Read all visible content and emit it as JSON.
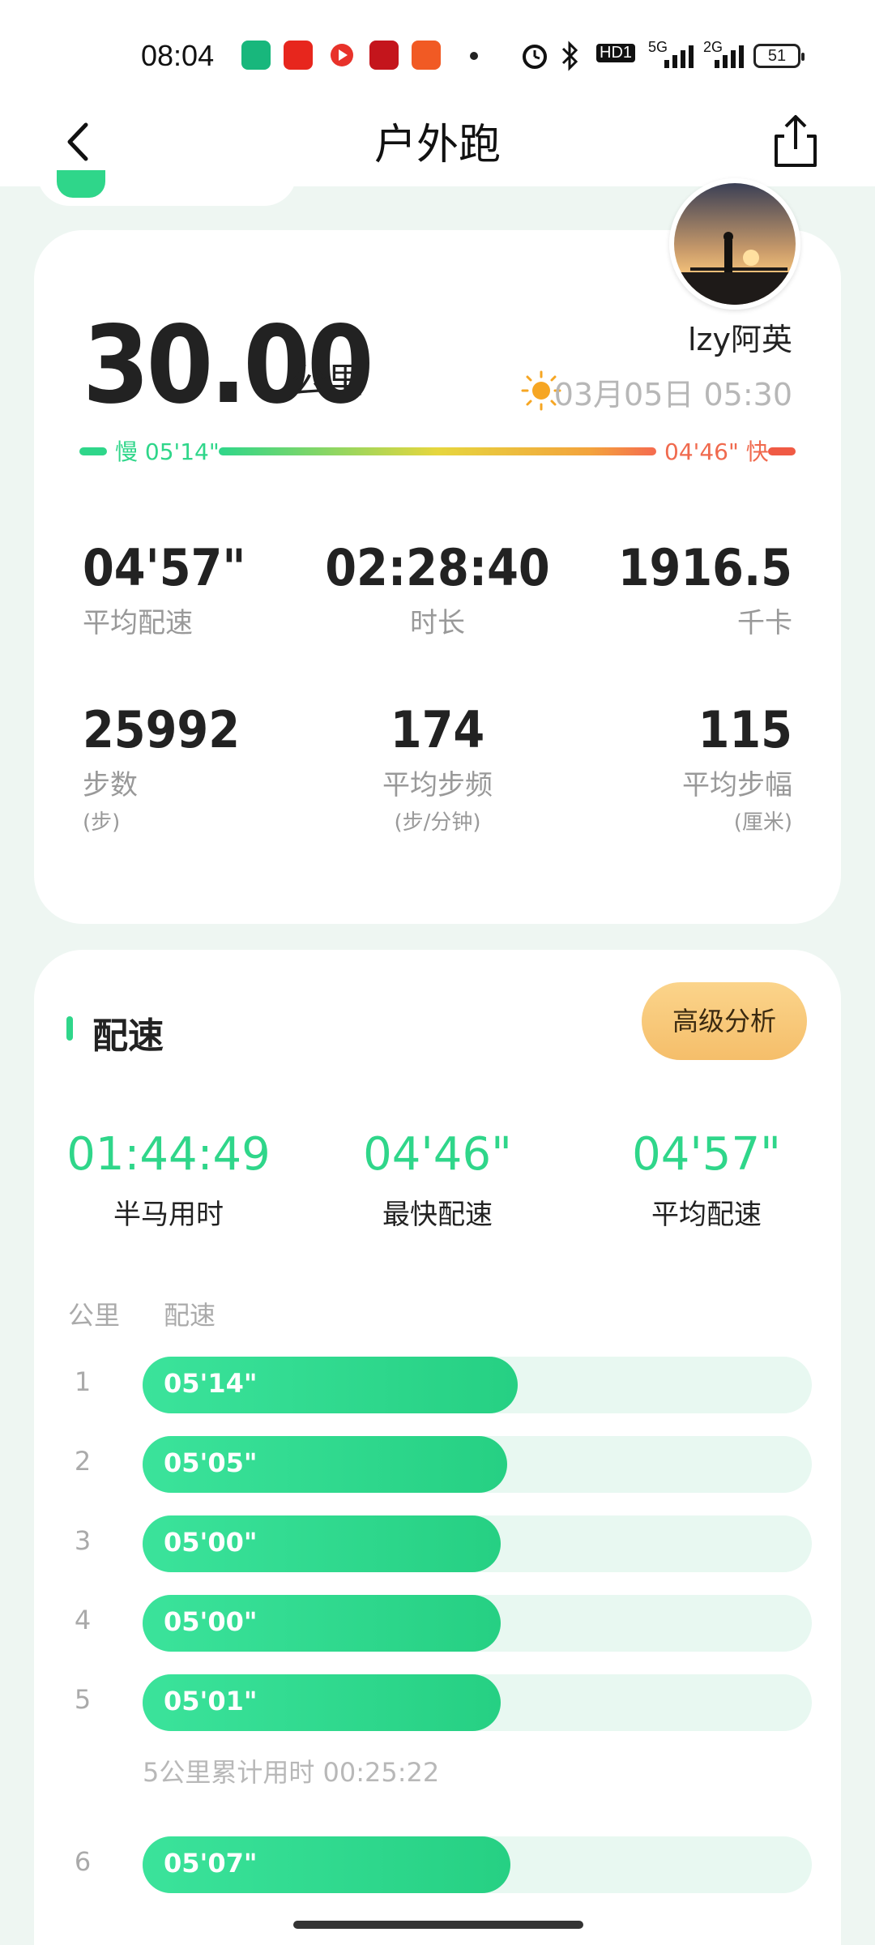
{
  "status_bar": {
    "time": "08:04",
    "network1": "5G",
    "network2": "2G",
    "hd": "HD1",
    "battery": "51"
  },
  "header": {
    "title": "户外跑"
  },
  "summary": {
    "distance": "30.00",
    "distance_unit": "公里",
    "user": "lzy阿英",
    "datetime": "03月05日 05:30",
    "pace_slow": "慢 05'14\"",
    "pace_fast": "04'46\" 快",
    "stats": [
      {
        "value": "04'57\"",
        "label": "平均配速",
        "unit": ""
      },
      {
        "value": "02:28:40",
        "label": "时长",
        "unit": ""
      },
      {
        "value": "1916.5",
        "label": "千卡",
        "unit": ""
      },
      {
        "value": "25992",
        "label": "步数",
        "unit": "(步)"
      },
      {
        "value": "174",
        "label": "平均步频",
        "unit": "(步/分钟)"
      },
      {
        "value": "115",
        "label": "平均步幅",
        "unit": "(厘米)"
      }
    ]
  },
  "pace_section": {
    "title": "配速",
    "advanced_button": "高级分析",
    "highlights": [
      {
        "value": "01:44:49",
        "label": "半马用时"
      },
      {
        "value": "04'46\"",
        "label": "最快配速"
      },
      {
        "value": "04'57\"",
        "label": "平均配速"
      }
    ],
    "col_km": "公里",
    "col_pace": "配速",
    "splits": [
      {
        "km": "1",
        "pace": "05'14\"",
        "fraction": 0.56
      },
      {
        "km": "2",
        "pace": "05'05\"",
        "fraction": 0.545
      },
      {
        "km": "3",
        "pace": "05'00\"",
        "fraction": 0.535
      },
      {
        "km": "4",
        "pace": "05'00\"",
        "fraction": 0.535
      },
      {
        "km": "5",
        "pace": "05'01\"",
        "fraction": 0.535
      },
      {
        "km": "6",
        "pace": "05'07\"",
        "fraction": 0.55
      }
    ],
    "cumulative_5km": "5公里累计用时 00:25:22"
  },
  "colors": {
    "accent": "#2fd68a",
    "fast": "#f06a4e",
    "button": "#f5be6a"
  }
}
